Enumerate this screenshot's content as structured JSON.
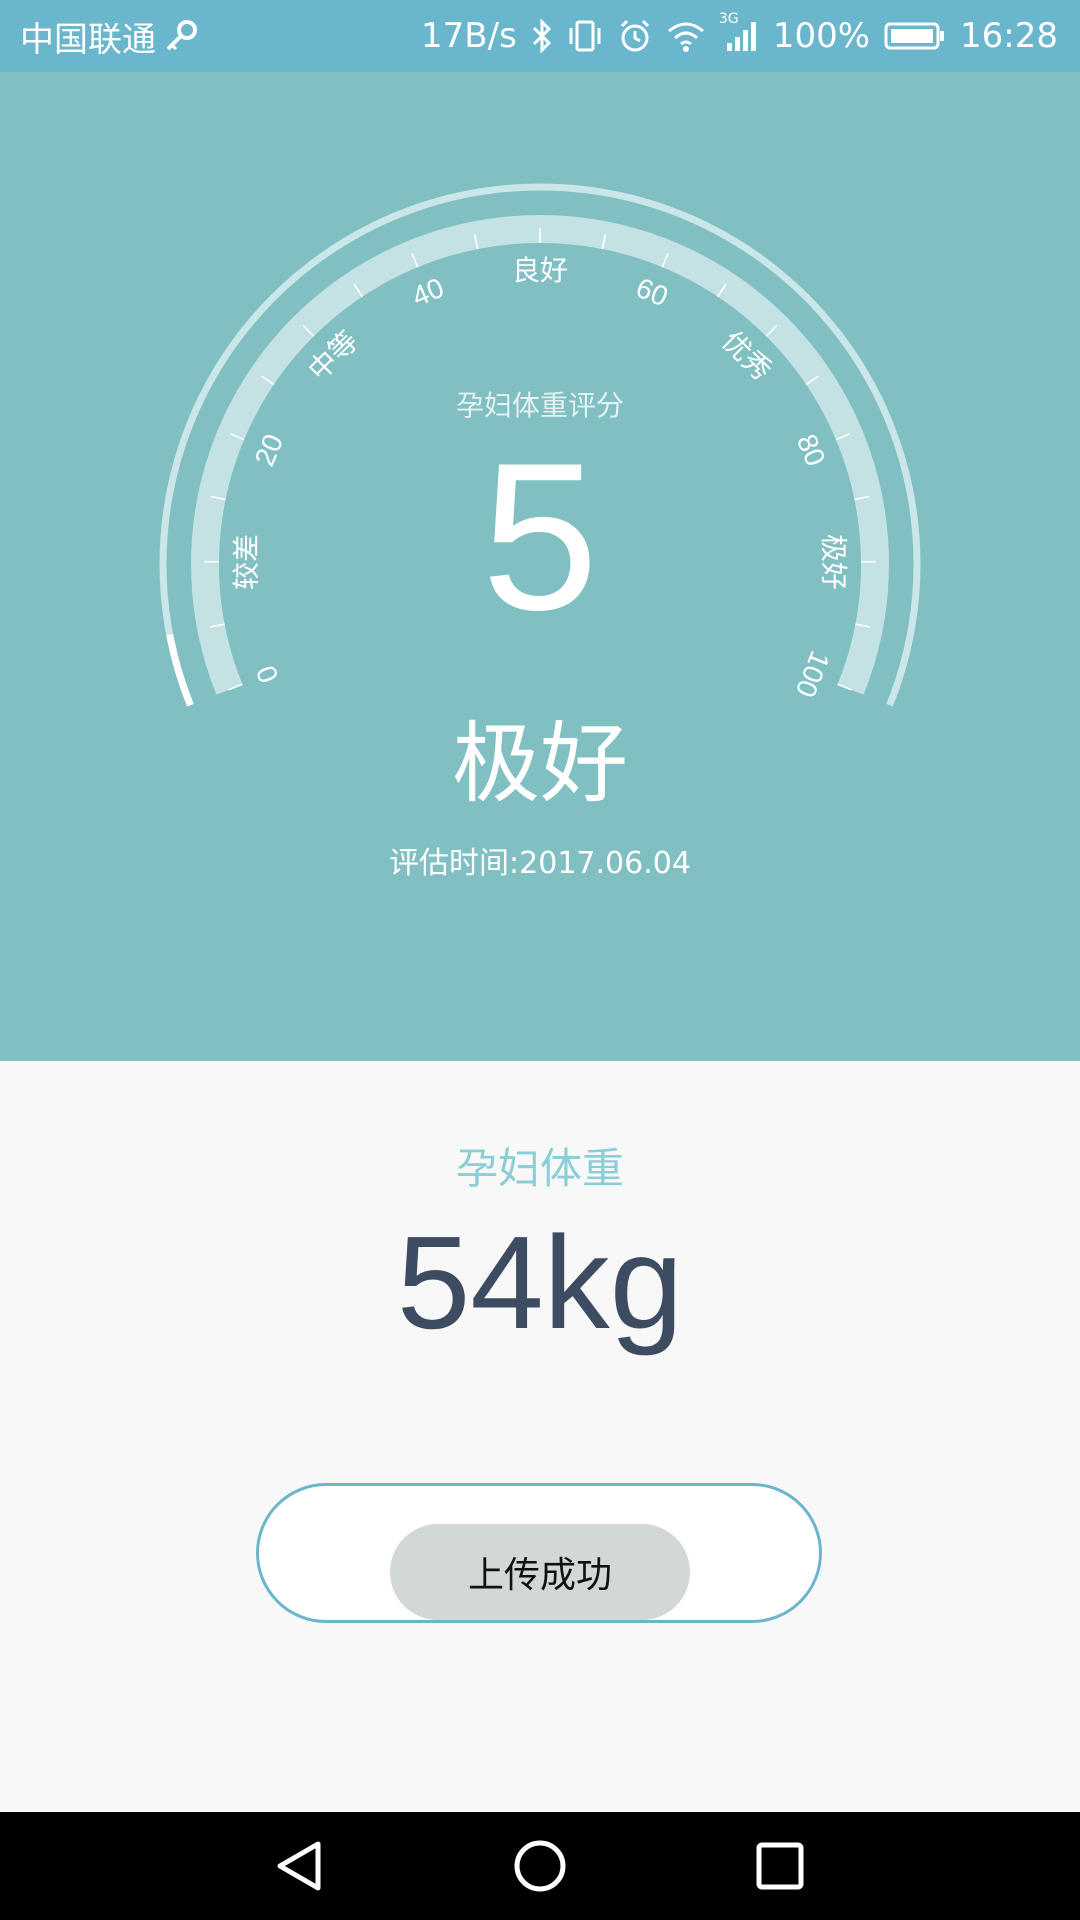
{
  "status_bar": {
    "carrier": "中国联通",
    "net_speed": "17B/s",
    "network_type": "3G",
    "battery": "100%",
    "time": "16:28",
    "icons": [
      "key-icon",
      "bluetooth-icon",
      "vibrate-icon",
      "alarm-icon",
      "wifi-icon",
      "signal-icon",
      "battery-icon"
    ]
  },
  "gauge": {
    "title": "孕妇体重评分",
    "score": "5",
    "score_value": 5,
    "range": [
      0,
      100
    ],
    "scale_labels": [
      "0",
      "20",
      "40",
      "60",
      "80",
      "100"
    ],
    "grade_labels": [
      "较差",
      "中等",
      "良好",
      "优秀",
      "极好"
    ]
  },
  "grade": "极好",
  "eval_time": "评估时间:2017.06.04",
  "weight": {
    "label": "孕妇体重",
    "value": "54kg"
  },
  "upload_button": "上传成功",
  "nav": {
    "icons": [
      "back-icon",
      "home-icon",
      "recents-icon"
    ]
  },
  "colors": {
    "status_bar": "#6ab6cc",
    "hero_bg": "#80bfc2",
    "weight_label": "#8cced7",
    "weight_value": "#3d4c61",
    "button_border": "#6ab6cc",
    "button_fill": "#d2d7d7"
  }
}
